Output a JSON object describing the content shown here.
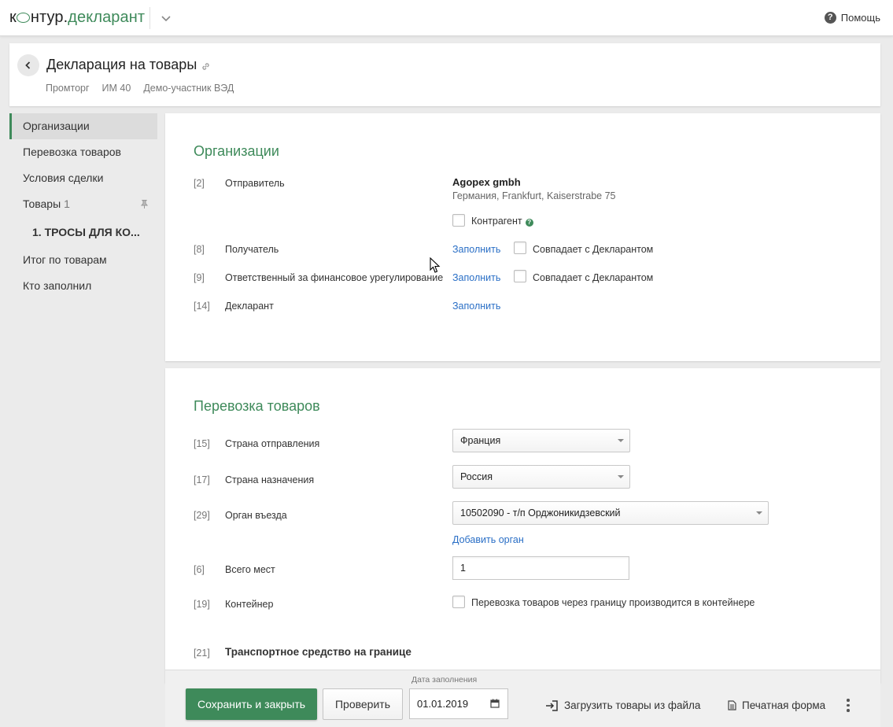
{
  "app": {
    "logo_prefix": "к",
    "logo_mid": "нтур.",
    "logo_accent": "декларант",
    "help_label": "Помощь"
  },
  "header": {
    "title": "Декларация на товары",
    "meta": [
      "Промторг",
      "ИМ 40",
      "Демо-участник ВЭД"
    ]
  },
  "sidebar": {
    "items": [
      {
        "label": "Организации"
      },
      {
        "label": "Перевозка товаров"
      },
      {
        "label": "Условия сделки"
      },
      {
        "label": "Товары",
        "count": "1"
      },
      {
        "label": "1. ТРОСЫ ДЛЯ КО..."
      },
      {
        "label": "Итог по товарам"
      },
      {
        "label": "Кто заполнил"
      }
    ]
  },
  "organizations": {
    "title": "Организации",
    "sender": {
      "num": "[2]",
      "label": "Отправитель",
      "name": "Agopex gmbh",
      "address": "Германия, Frankfurt, Kaiserstrabe 75",
      "counterparty_label": "Контрагент"
    },
    "receiver": {
      "num": "[8]",
      "label": "Получатель",
      "fill": "Заполнить",
      "same_label": "Совпадает с Декларантом"
    },
    "financial": {
      "num": "[9]",
      "label": "Ответственный за финансовое урегулирование",
      "fill": "Заполнить",
      "same_label": "Совпадает с Декларантом"
    },
    "declarant": {
      "num": "[14]",
      "label": "Декларант",
      "fill": "Заполнить"
    }
  },
  "transport": {
    "title": "Перевозка товаров",
    "departure": {
      "num": "[15]",
      "label": "Страна отправления",
      "value": "Франция"
    },
    "destination": {
      "num": "[17]",
      "label": "Страна назначения",
      "value": "Россия"
    },
    "entry_body": {
      "num": "[29]",
      "label": "Орган въезда",
      "value": "10502090 - т/п Орджоникидзевский",
      "add_label": "Добавить орган"
    },
    "places": {
      "num": "[6]",
      "label": "Всего мест",
      "value": "1"
    },
    "container": {
      "num": "[19]",
      "label": "Контейнер",
      "checkbox_label": "Перевозка товаров через границу производится в контейнере"
    },
    "vehicle": {
      "num": "[21]",
      "label": "Транспортное средство на границе"
    }
  },
  "footer": {
    "save_label": "Сохранить и закрыть",
    "check_label": "Проверить",
    "date_caption": "Дата заполнения",
    "date_value": "01.01.2019",
    "upload_label": "Загрузить товары из файла",
    "print_label": "Печатная форма"
  },
  "colors": {
    "accent": "#3e8a5a",
    "link": "#2a6fc6"
  }
}
